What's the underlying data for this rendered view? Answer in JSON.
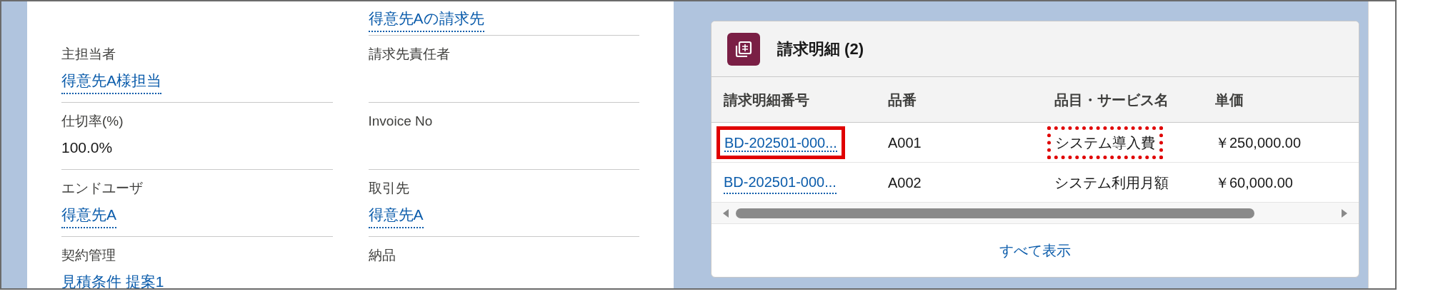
{
  "record_fields": [
    {
      "right": {
        "value": "得意先Aの請求先",
        "link": true
      }
    },
    {
      "left": {
        "label": "主担当者",
        "value": "得意先A様担当",
        "link": true
      },
      "right": {
        "label": "請求先責任者"
      }
    },
    {
      "left": {
        "label": "仕切率(%)",
        "value": "100.0%",
        "link": false
      },
      "right": {
        "label": "Invoice No"
      }
    },
    {
      "left": {
        "label": "エンドユーザ",
        "value": "得意先A",
        "link": true
      },
      "right": {
        "label": "取引先",
        "value": "得意先A",
        "link": true
      }
    },
    {
      "left": {
        "label": "契約管理",
        "value": "見積条件 提案1",
        "link": true
      },
      "right": {
        "label": "納品"
      }
    }
  ],
  "related_list": {
    "title": "請求明細 (2)",
    "columns": [
      "請求明細番号",
      "品番",
      "品目・サービス名",
      "単価"
    ],
    "rows": [
      {
        "cells": [
          {
            "text": "BD-202501-000...",
            "link": true,
            "highlight": {
              "kind": "solid"
            }
          },
          {
            "text": "A001",
            "link": false
          },
          {
            "text": "システム導入費",
            "link": false,
            "highlight": {
              "kind": "dotted"
            }
          },
          {
            "text": "￥250,000.00",
            "link": false
          }
        ]
      },
      {
        "cells": [
          {
            "text": "BD-202501-000...",
            "link": true
          },
          {
            "text": "A002",
            "link": false
          },
          {
            "text": "システム利用月額",
            "link": false
          },
          {
            "text": "￥60,000.00",
            "link": false
          }
        ]
      }
    ],
    "view_all": "すべて表示"
  }
}
